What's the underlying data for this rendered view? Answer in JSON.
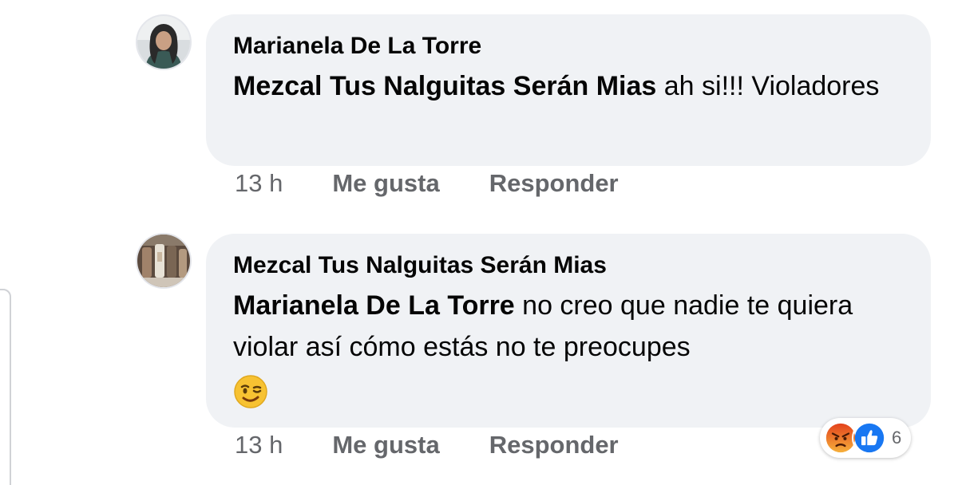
{
  "comments": [
    {
      "author": "Marianela De La Torre",
      "mention": "Mezcal Tus Nalguitas Serán Mias",
      "text": " ah si!!! Violadores",
      "time": "13 h",
      "like_label": "Me gusta",
      "reply_label": "Responder",
      "avatar_icon": "profile-photo"
    },
    {
      "author": "Mezcal Tus Nalguitas Serán Mias",
      "mention": "Marianela De La Torre",
      "text": " no creo que nadie te quiera violar así cómo estás no te preocupes",
      "emoji": "winking-face-emoji",
      "time": "13 h",
      "like_label": "Me gusta",
      "reply_label": "Responder",
      "avatar_icon": "bottles-photo",
      "reactions": {
        "icons": [
          "angry-reaction-icon",
          "like-reaction-icon"
        ],
        "count": "6"
      }
    }
  ],
  "colors": {
    "bubble": "#f0f2f5",
    "secondary_text": "#65676b",
    "like_blue": "#1877f2",
    "angry_orange": "#e9710f"
  }
}
